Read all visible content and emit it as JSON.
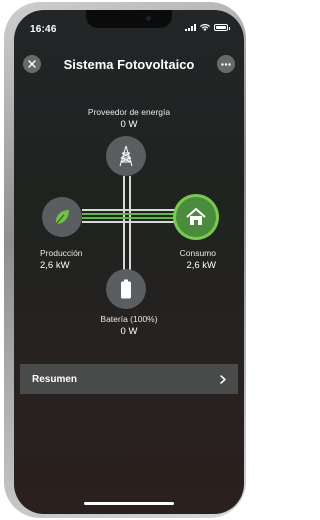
{
  "status_bar": {
    "time": "16:46"
  },
  "header": {
    "title": "Sistema Fotovoltaico"
  },
  "grid": {
    "label": "Proveedor de energía",
    "value": "0 W"
  },
  "production": {
    "label": "Producción",
    "value": "2,6 kW"
  },
  "consumption": {
    "label": "Consumo",
    "value": "2,6 kW"
  },
  "battery": {
    "label": "Batería (100%)",
    "value": "0 W"
  },
  "summary": {
    "label": "Resumen"
  },
  "colors": {
    "accent": "#5fba46",
    "node": "#5b5e60"
  }
}
